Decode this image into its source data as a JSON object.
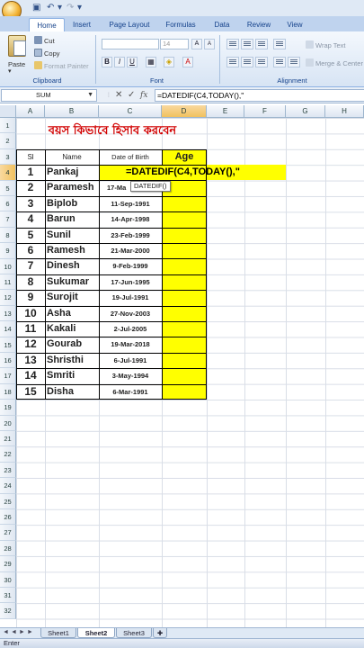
{
  "ribbon": {
    "tabs": [
      "Home",
      "Insert",
      "Page Layout",
      "Formulas",
      "Data",
      "Review",
      "View"
    ],
    "active_tab": "Home",
    "clipboard": {
      "paste": "Paste",
      "cut": "Cut",
      "copy": "Copy",
      "format_painter": "Format Painter",
      "label": "Clipboard"
    },
    "font": {
      "font_size": "14",
      "bold": "B",
      "italic": "I",
      "underline": "U",
      "label": "Font"
    },
    "alignment": {
      "wrap_text": "Wrap Text",
      "merge_center": "Merge & Center",
      "label": "Alignment"
    }
  },
  "formula_bar": {
    "name_box": "SUM",
    "cancel": "✕",
    "enter": "✓",
    "fx": "fx",
    "formula": "=DATEDIF(C4,TODAY(),\""
  },
  "grid": {
    "columns": [
      "A",
      "B",
      "C",
      "D",
      "E",
      "F",
      "G",
      "H"
    ],
    "selected_column": "D",
    "rows": [
      "1",
      "2",
      "3",
      "4",
      "5",
      "6",
      "7",
      "8",
      "9",
      "10",
      "11",
      "12",
      "13",
      "14",
      "15",
      "16",
      "17",
      "18",
      "19",
      "20",
      "21",
      "22",
      "23",
      "24",
      "25",
      "26",
      "27",
      "28",
      "29",
      "30",
      "31",
      "32"
    ],
    "selected_row": "4"
  },
  "sheet": {
    "title": "বয়স কিভাবে হিসাব করবেন",
    "headers": {
      "sl": "Sl",
      "name": "Name",
      "dob": "Date of Birth",
      "age": "Age"
    },
    "edit_formula": "=DATEDIF(C4,TODAY(),\"",
    "tooltip": "DATEDIF()",
    "rows": [
      {
        "sl": "1",
        "name": "Pankaj",
        "dob": ""
      },
      {
        "sl": "2",
        "name": "Paramesh",
        "dob": "17-Ma"
      },
      {
        "sl": "3",
        "name": "Biplob",
        "dob": "11-Sep-1991"
      },
      {
        "sl": "4",
        "name": "Barun",
        "dob": "14-Apr-1998"
      },
      {
        "sl": "5",
        "name": "Sunil",
        "dob": "23-Feb-1999"
      },
      {
        "sl": "6",
        "name": "Ramesh",
        "dob": "21-Mar-2000"
      },
      {
        "sl": "7",
        "name": "Dinesh",
        "dob": "9-Feb-1999"
      },
      {
        "sl": "8",
        "name": "Sukumar",
        "dob": "17-Jun-1995"
      },
      {
        "sl": "9",
        "name": "Surojit",
        "dob": "19-Jul-1991"
      },
      {
        "sl": "10",
        "name": "Asha",
        "dob": "27-Nov-2003"
      },
      {
        "sl": "11",
        "name": "Kakali",
        "dob": "2-Jul-2005"
      },
      {
        "sl": "12",
        "name": "Gourab",
        "dob": "19-Mar-2018"
      },
      {
        "sl": "13",
        "name": "Shristhi",
        "dob": "6-Jul-1991"
      },
      {
        "sl": "14",
        "name": "Smriti",
        "dob": "3-May-1994"
      },
      {
        "sl": "15",
        "name": "Disha",
        "dob": "6-Mar-1991"
      }
    ]
  },
  "sheet_tabs": [
    "Sheet1",
    "Sheet2",
    "Sheet3"
  ],
  "active_sheet": "Sheet2",
  "status": "Enter",
  "colors": {
    "highlight": "#ffff00",
    "title": "#d10000",
    "ribbon": "#dfe9f5"
  }
}
